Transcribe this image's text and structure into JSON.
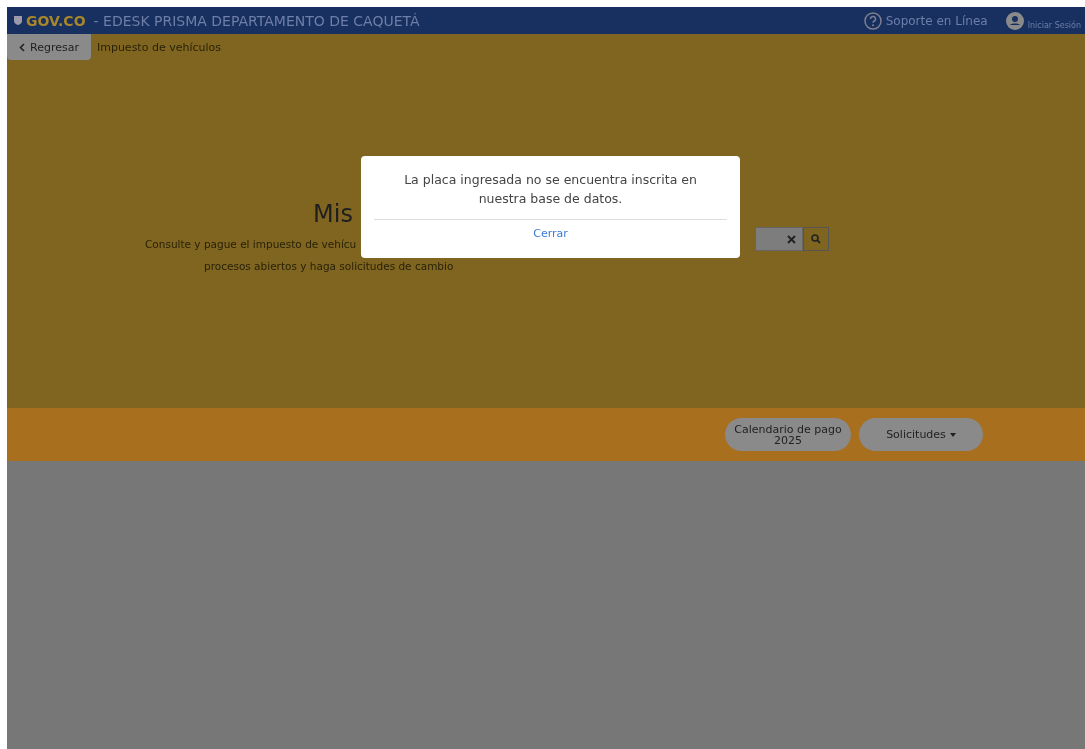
{
  "header": {
    "logo": "GOV.CO",
    "title": "- EDESK PRISMA DEPARTAMENTO DE CAQUETÁ",
    "support": "Soporte en Línea",
    "login": "Iniciar Sesión"
  },
  "subbar": {
    "back": "Regresar",
    "breadcrumb": "Impuesto de vehículos"
  },
  "hero": {
    "heading": "Mis",
    "description": [
      "Consulte y pague el impuesto de vehícu",
      "procesos abiertos y haga solicitudes de cambio"
    ]
  },
  "actions": [
    {
      "kind": "plain",
      "label": "Calendario de pago 2025"
    },
    {
      "kind": "dropdown",
      "label": "Solicitudes"
    }
  ],
  "modal": {
    "message": "La placa ingresada no se encuentra inscrita en nuestra base de datos.",
    "button": "Cerrar"
  }
}
